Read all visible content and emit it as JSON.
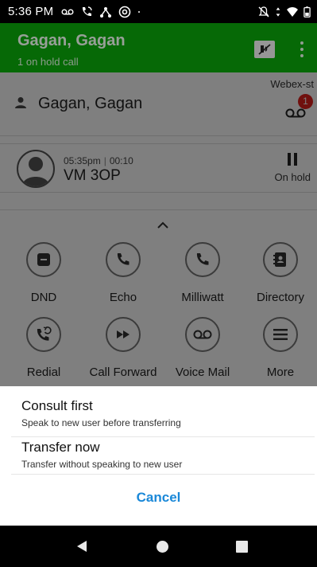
{
  "status_bar": {
    "time": "5:36 PM",
    "left_icons": [
      "voicemail-icon",
      "call-icon",
      "network-icon",
      "at-icon",
      "dot-icon"
    ],
    "right_icons": [
      "mute-vibrate-icon",
      "data-arrows-icon",
      "wifi-icon",
      "battery-icon"
    ]
  },
  "header": {
    "title": "Gagan, Gagan",
    "subtitle": "1 on hold call",
    "background": "#0aa10a"
  },
  "contact": {
    "line_label": "Webex-st",
    "name": "Gagan, Gagan",
    "voicemail_badge": "1"
  },
  "call": {
    "time": "05:35pm",
    "separator": "|",
    "duration": "00:10",
    "name": "VM 3OP",
    "hold_label": "On hold"
  },
  "actions": [
    {
      "label": "DND",
      "icon": "dnd-icon"
    },
    {
      "label": "Echo",
      "icon": "phone-icon"
    },
    {
      "label": "Milliwatt",
      "icon": "phone-icon"
    },
    {
      "label": "Directory",
      "icon": "directory-icon"
    },
    {
      "label": "Redial",
      "icon": "redial-icon"
    },
    {
      "label": "Call Forward",
      "icon": "fast-forward-icon"
    },
    {
      "label": "Voice Mail",
      "icon": "voicemail-icon"
    },
    {
      "label": "More",
      "icon": "menu-icon"
    }
  ],
  "transfer_sheet": {
    "consult_title": "Consult first",
    "consult_subtitle": "Speak to new user before transferring",
    "transfer_title": "Transfer now",
    "transfer_subtitle": "Transfer without speaking to new user",
    "cancel_label": "Cancel",
    "accent": "#1a88d8"
  }
}
